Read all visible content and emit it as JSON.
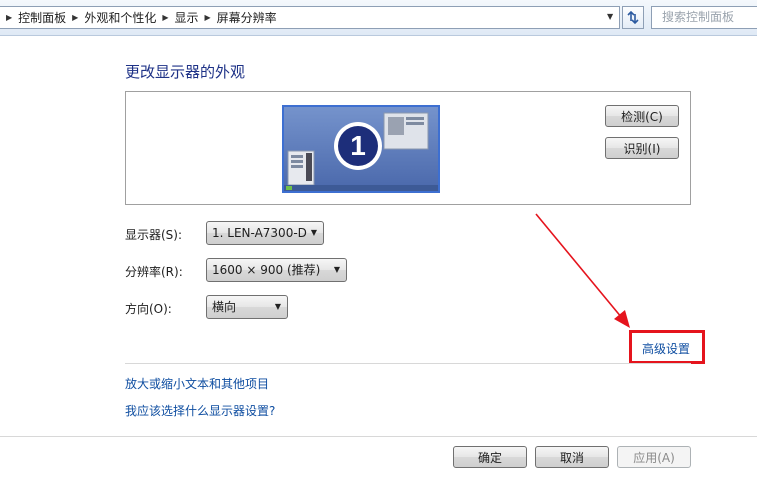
{
  "breadcrumbs": [
    "控制面板",
    "外观和个性化",
    "显示",
    "屏幕分辨率"
  ],
  "search": {
    "placeholder": "搜索控制面板"
  },
  "title": "更改显示器的外观",
  "monitor_number": "1",
  "buttons": {
    "detect": "检测(C)",
    "identify": "识别(I)"
  },
  "settings": {
    "display_label": "显示器(S):",
    "display_value": "1. LEN-A7300-D",
    "resolution_label": "分辨率(R):",
    "resolution_value": "1600 × 900 (推荐)",
    "orientation_label": "方向(O):",
    "orientation_value": "横向"
  },
  "advanced_link": "高级设置",
  "links": [
    "放大或缩小文本和其他项目",
    "我应该选择什么显示器设置?"
  ],
  "footer": {
    "ok": "确定",
    "cancel": "取消",
    "apply": "应用(A)"
  },
  "colors": {
    "accent": "#1e3287",
    "link": "#0f4ea1",
    "annotation": "#e5141d"
  }
}
